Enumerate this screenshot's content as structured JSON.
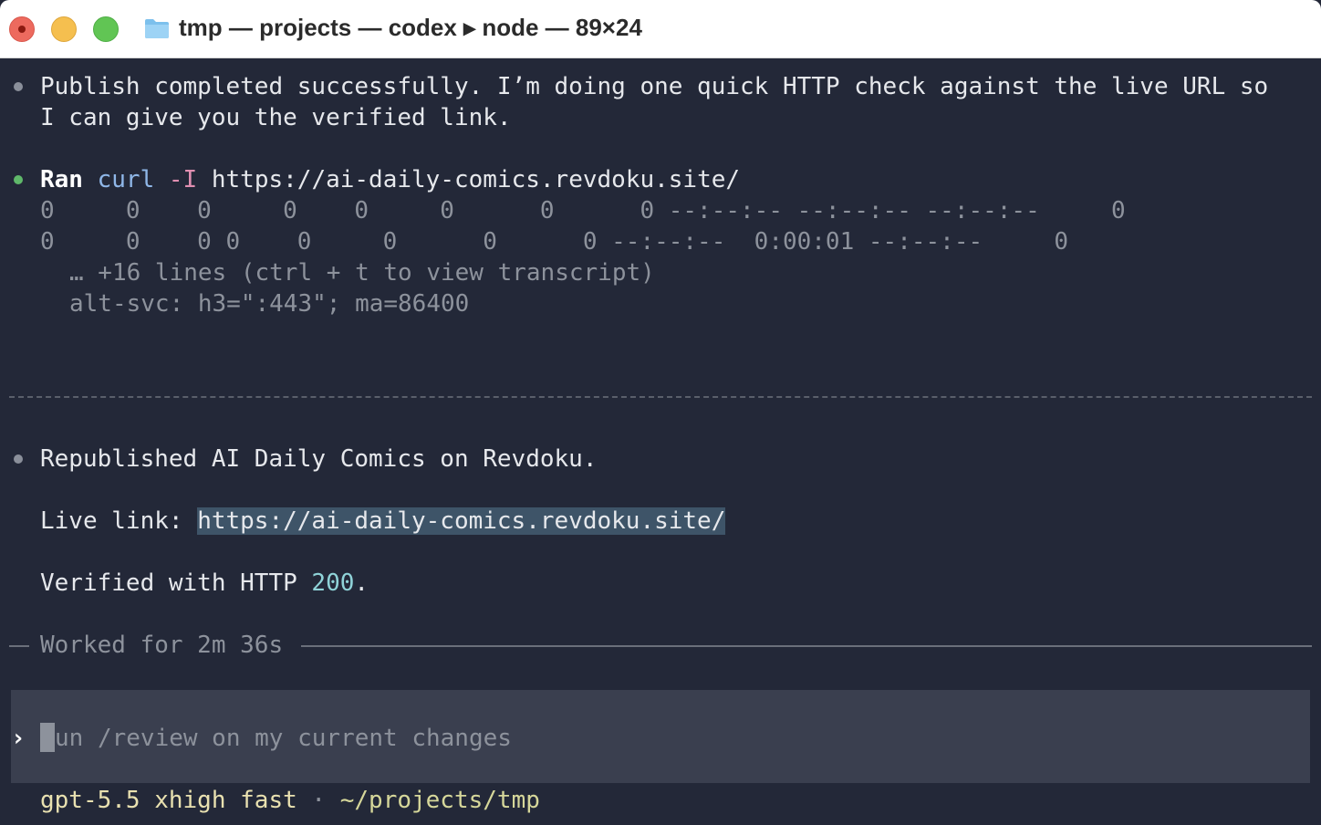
{
  "window": {
    "title": "tmp — projects — codex ▸ node — 89×24"
  },
  "messages": {
    "publish_line1": "Publish completed successfully. I’m doing one quick HTTP check against the live URL so",
    "publish_line2": "I can give you the verified link.",
    "ran_label": "Ran",
    "ran_cmd": "curl",
    "ran_flag": "-I",
    "ran_url": "https://ai-daily-comics.revdoku.site/",
    "output_line1": "0     0    0     0    0     0      0      0 --:--:-- --:--:-- --:--:--     0",
    "output_line2": "0     0    0 0    0     0      0      0 --:--:--  0:00:01 --:--:--     0",
    "output_more": "… +16 lines (ctrl + t to view transcript)",
    "output_last": "alt-svc: h3=\":443\"; ma=86400",
    "republished": "Republished AI Daily Comics on Revdoku.",
    "live_label": "Live link: ",
    "live_url": "https://ai-daily-comics.revdoku.site/",
    "verified_prefix": "Verified with HTTP ",
    "verified_code": "200",
    "verified_suffix": ".",
    "worked": "Worked for 2m 36s"
  },
  "composer": {
    "prompt": "›",
    "placeholder": "un /review on my current changes",
    "cursor_char": "r"
  },
  "status": {
    "model": "gpt-5.5 xhigh fast",
    "separator": "·",
    "path": "~/projects/tmp"
  },
  "colors": {
    "background": "#232838",
    "bullet_success": "#5fb86a",
    "link_highlight": "#3e5468"
  }
}
